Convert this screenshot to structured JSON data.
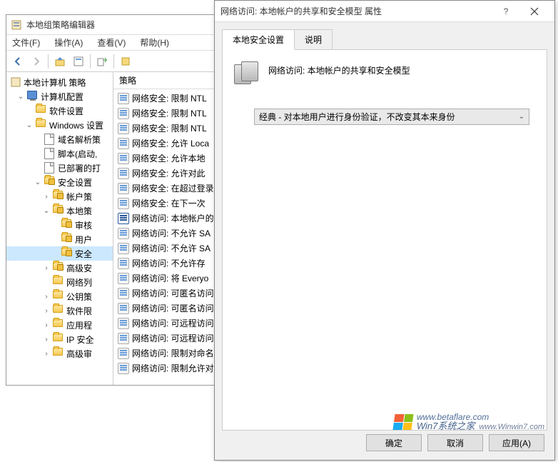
{
  "main": {
    "title": "本地组策略编辑器",
    "menus": [
      "文件(F)",
      "操作(A)",
      "查看(V)",
      "帮助(H)"
    ],
    "tree_root": "本地计算机 策略",
    "tree": [
      {
        "indent": 1,
        "expander": "v",
        "icon": "computer",
        "label": "计算机配置"
      },
      {
        "indent": 2,
        "expander": "",
        "icon": "folder",
        "label": "软件设置"
      },
      {
        "indent": 2,
        "expander": "v",
        "icon": "folder",
        "label": "Windows 设置"
      },
      {
        "indent": 3,
        "expander": "",
        "icon": "doc",
        "label": "域名解析策"
      },
      {
        "indent": 3,
        "expander": "",
        "icon": "doc",
        "label": "脚本(启动,"
      },
      {
        "indent": 3,
        "expander": "",
        "icon": "doc",
        "label": "已部署的打"
      },
      {
        "indent": 3,
        "expander": "v",
        "icon": "folder-lock",
        "label": "安全设置"
      },
      {
        "indent": 4,
        "expander": ">",
        "icon": "folder-lock",
        "label": "帐户策"
      },
      {
        "indent": 4,
        "expander": "v",
        "icon": "folder-lock",
        "label": "本地策"
      },
      {
        "indent": 5,
        "expander": "",
        "icon": "folder-lock",
        "label": "审核"
      },
      {
        "indent": 5,
        "expander": "",
        "icon": "folder-lock",
        "label": "用户"
      },
      {
        "indent": 5,
        "expander": "",
        "icon": "folder-lock",
        "label": "安全",
        "selected": true
      },
      {
        "indent": 4,
        "expander": ">",
        "icon": "folder-lock",
        "label": "高级安"
      },
      {
        "indent": 4,
        "expander": "",
        "icon": "folder",
        "label": "网络列"
      },
      {
        "indent": 4,
        "expander": ">",
        "icon": "folder",
        "label": "公钥策"
      },
      {
        "indent": 4,
        "expander": ">",
        "icon": "folder",
        "label": "软件限"
      },
      {
        "indent": 4,
        "expander": ">",
        "icon": "folder",
        "label": "应用程"
      },
      {
        "indent": 4,
        "expander": ">",
        "icon": "folder",
        "label": "IP 安全"
      },
      {
        "indent": 4,
        "expander": ">",
        "icon": "folder",
        "label": "高级审"
      }
    ],
    "list_header": "策略",
    "policies": [
      {
        "label": "网络安全: 限制 NTL"
      },
      {
        "label": "网络安全: 限制 NTL"
      },
      {
        "label": "网络安全: 限制 NTL"
      },
      {
        "label": "网络安全: 允许 Loca"
      },
      {
        "label": "网络安全: 允许本地"
      },
      {
        "label": "网络安全: 允许对此"
      },
      {
        "label": "网络安全: 在超过登录"
      },
      {
        "label": "网络安全: 在下一次"
      },
      {
        "label": "网络访问: 本地帐户的",
        "highlight": true
      },
      {
        "label": "网络访问: 不允许 SA"
      },
      {
        "label": "网络访问: 不允许 SA"
      },
      {
        "label": "网络访问: 不允许存"
      },
      {
        "label": "网络访问: 将 Everyo"
      },
      {
        "label": "网络访问: 可匿名访问"
      },
      {
        "label": "网络访问: 可匿名访问"
      },
      {
        "label": "网络访问: 可远程访问"
      },
      {
        "label": "网络访问: 可远程访问"
      },
      {
        "label": "网络访问: 限制对命名"
      },
      {
        "label": "网络访问: 限制允许对"
      }
    ]
  },
  "dialog": {
    "title": "网络访问: 本地帐户的共享和安全模型 属性",
    "tabs": [
      "本地安全设置",
      "说明"
    ],
    "policy_name": "网络访问: 本地帐户的共享和安全模型",
    "dropdown_value": "经典 - 对本地用户进行身份验证，不改变其本来身份",
    "buttons": {
      "ok": "确定",
      "cancel": "取消",
      "apply": "应用(A)"
    }
  },
  "watermark": {
    "line1": "www.betaflare.com",
    "line2": "Win7系统之家",
    "line3": "www.Winwin7.com"
  }
}
